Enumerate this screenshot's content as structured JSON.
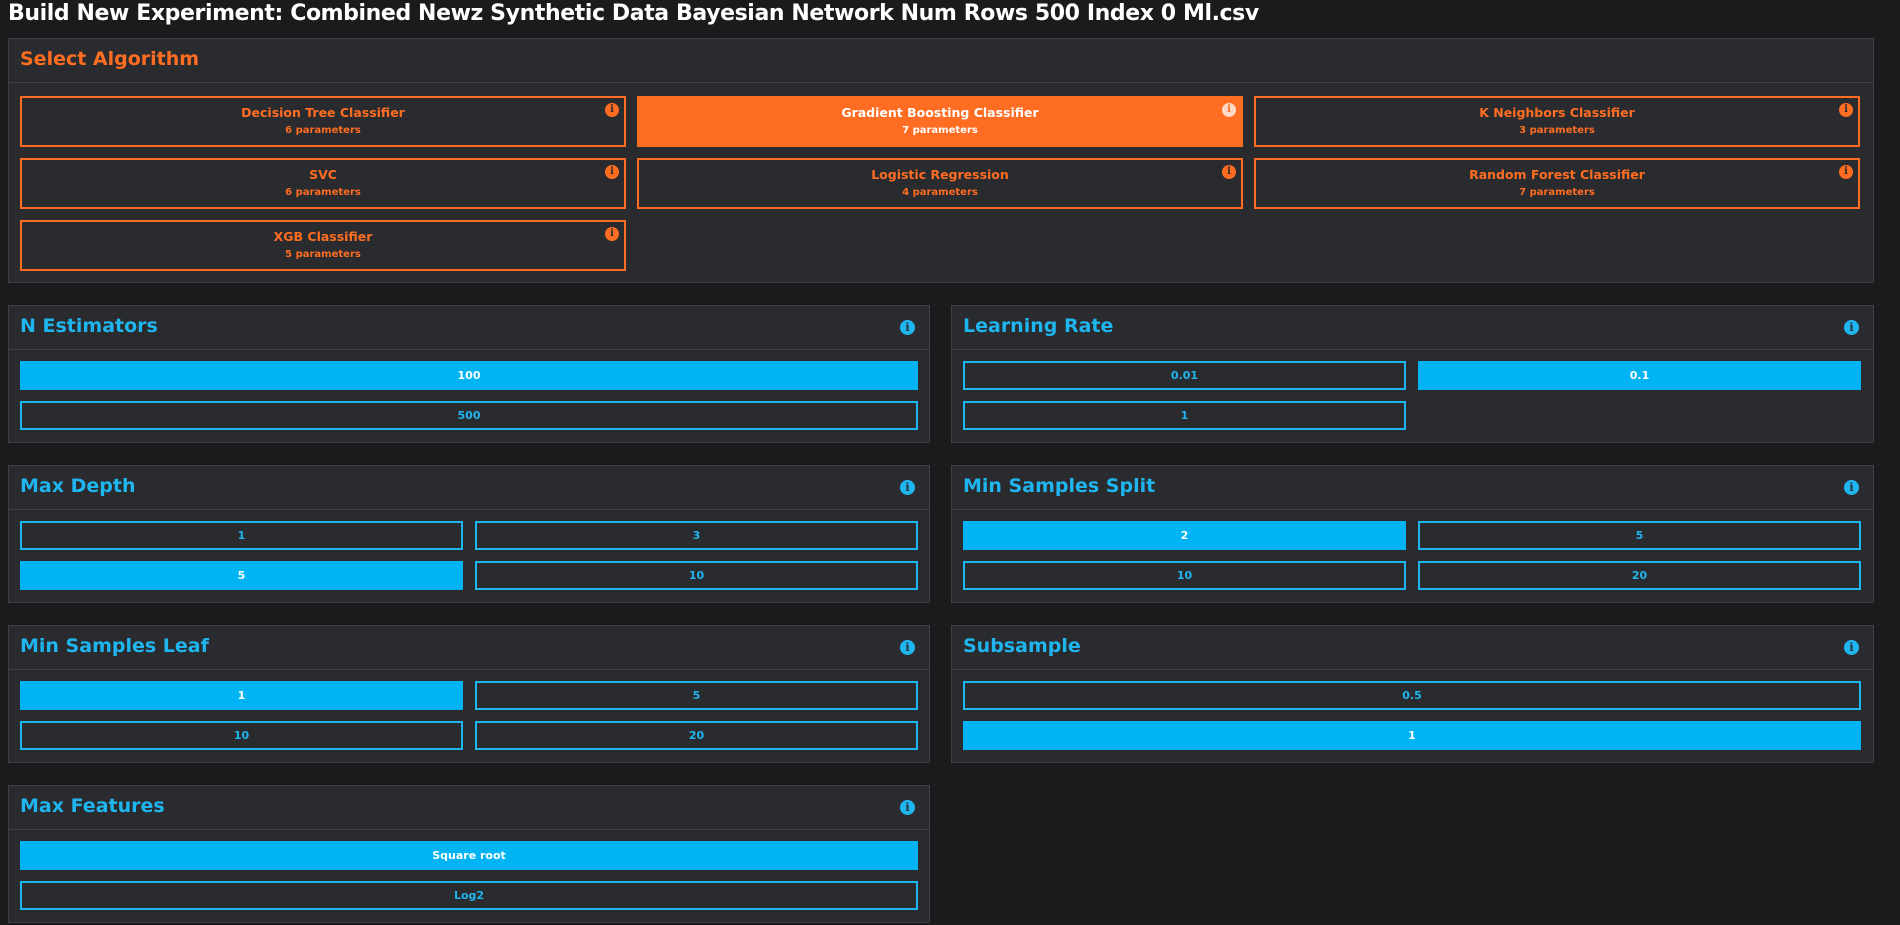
{
  "page_title": "Build New Experiment: Combined Newz Synthetic Data Bayesian Network Num Rows 500 Index 0 Ml.csv",
  "colors": {
    "background": "#1a1b1d",
    "panel": "#2a2b2e",
    "algorithm_accent": "#ff6d22",
    "parameter_accent": "#1fb6f0",
    "selected_fill": "#00b4f4"
  },
  "algorithm_panel": {
    "title": "Select Algorithm",
    "algorithms": [
      {
        "name": "Decision Tree Classifier",
        "params": "6 parameters",
        "selected": false
      },
      {
        "name": "Gradient Boosting Classifier",
        "params": "7 parameters",
        "selected": true
      },
      {
        "name": "K Neighbors Classifier",
        "params": "3 parameters",
        "selected": false
      },
      {
        "name": "SVC",
        "params": "6 parameters",
        "selected": false
      },
      {
        "name": "Logistic Regression",
        "params": "4 parameters",
        "selected": false
      },
      {
        "name": "Random Forest Classifier",
        "params": "7 parameters",
        "selected": false
      },
      {
        "name": "XGB Classifier",
        "params": "5 parameters",
        "selected": false
      }
    ]
  },
  "parameters": {
    "n_estimators": {
      "title": "N Estimators",
      "options": [
        "100",
        "500"
      ],
      "selected": "100"
    },
    "learning_rate": {
      "title": "Learning Rate",
      "options": [
        "0.01",
        "0.1",
        "1"
      ],
      "selected": "0.1"
    },
    "max_depth": {
      "title": "Max Depth",
      "options": [
        "1",
        "3",
        "5",
        "10"
      ],
      "selected": "5"
    },
    "min_samples_split": {
      "title": "Min Samples Split",
      "options": [
        "2",
        "5",
        "10",
        "20"
      ],
      "selected": "2"
    },
    "min_samples_leaf": {
      "title": "Min Samples Leaf",
      "options": [
        "1",
        "5",
        "10",
        "20"
      ],
      "selected": "1"
    },
    "subsample": {
      "title": "Subsample",
      "options": [
        "0.5",
        "1"
      ],
      "selected": "1"
    },
    "max_features": {
      "title": "Max Features",
      "options": [
        "Square root",
        "Log2"
      ],
      "selected": "Square root"
    }
  },
  "icons": {
    "info": "info-circle-icon",
    "info_glyph": "i"
  }
}
